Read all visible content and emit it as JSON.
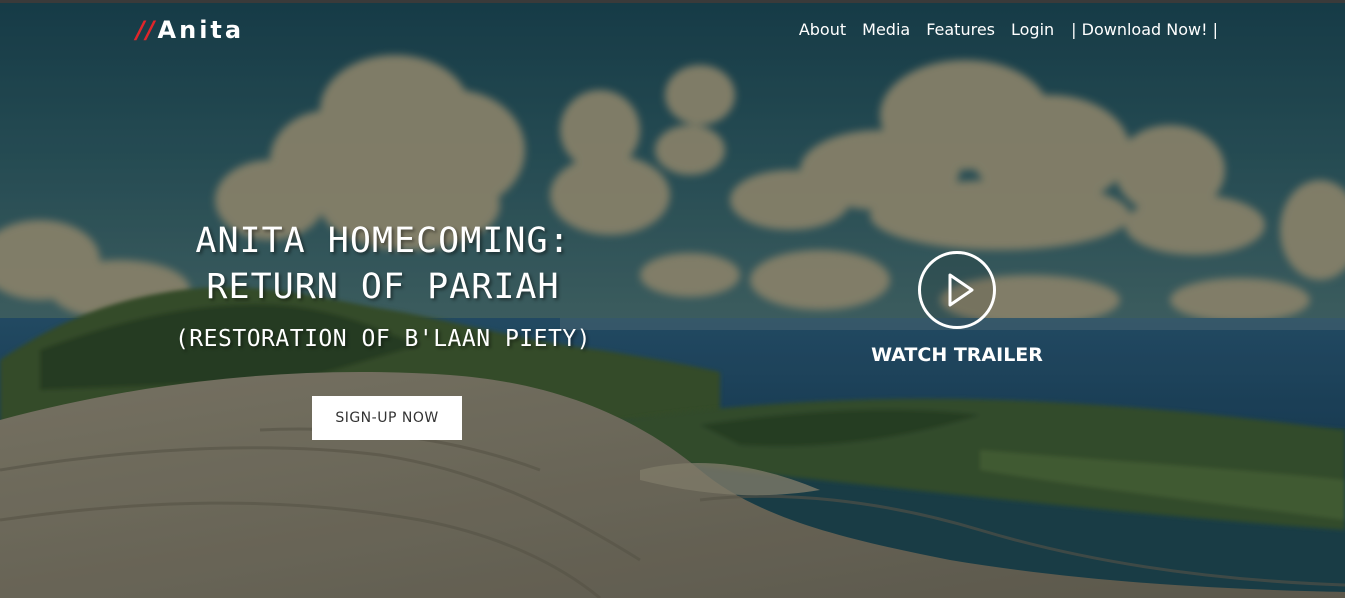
{
  "header": {
    "logo_prefix": "//",
    "logo_name": "Anita",
    "nav": {
      "about": "About",
      "media": "Media",
      "features": "Features",
      "login": "Login",
      "download": "| Download Now! |"
    }
  },
  "hero": {
    "title_line1": "ANITA HOMECOMING:",
    "title_line2": "RETURN OF PARIAH",
    "subtitle": "(RESTORATION OF B'LAAN PIETY)",
    "signup_label": "SIGN-UP NOW"
  },
  "trailer": {
    "label": "WATCH TRAILER",
    "icon": "play-icon"
  },
  "colors": {
    "logo_accent": "#e0262b",
    "text": "#ffffff",
    "button_bg": "#ffffff",
    "button_text": "#333333"
  }
}
